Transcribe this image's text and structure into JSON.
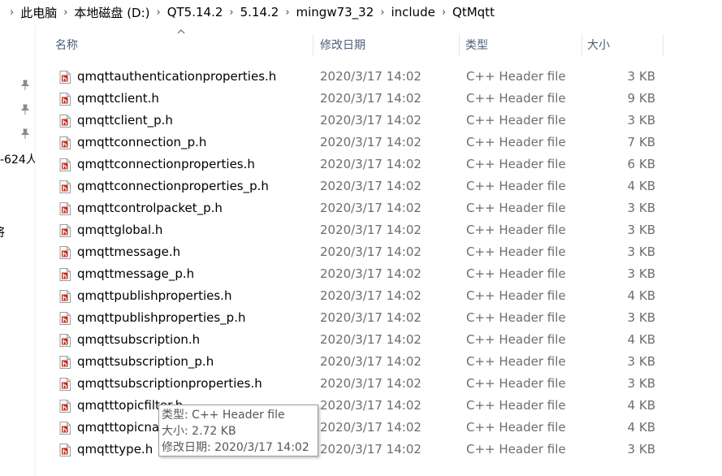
{
  "breadcrumb": {
    "items": [
      "此电脑",
      "本地磁盘 (D:)",
      "QT5.14.2",
      "5.14.2",
      "mingw73_32",
      "include",
      "QtMqtt"
    ],
    "separator": "›"
  },
  "nav": {
    "fragment_1": "-624人",
    "fragment_2": "将"
  },
  "columns": {
    "name": "名称",
    "date": "修改日期",
    "type": "类型",
    "size": "大小"
  },
  "files": [
    {
      "name": "qmqttauthenticationproperties.h",
      "date": "2020/3/17 14:02",
      "type": "C++ Header file",
      "size": "3 KB"
    },
    {
      "name": "qmqttclient.h",
      "date": "2020/3/17 14:02",
      "type": "C++ Header file",
      "size": "9 KB"
    },
    {
      "name": "qmqttclient_p.h",
      "date": "2020/3/17 14:02",
      "type": "C++ Header file",
      "size": "3 KB"
    },
    {
      "name": "qmqttconnection_p.h",
      "date": "2020/3/17 14:02",
      "type": "C++ Header file",
      "size": "7 KB"
    },
    {
      "name": "qmqttconnectionproperties.h",
      "date": "2020/3/17 14:02",
      "type": "C++ Header file",
      "size": "6 KB"
    },
    {
      "name": "qmqttconnectionproperties_p.h",
      "date": "2020/3/17 14:02",
      "type": "C++ Header file",
      "size": "4 KB"
    },
    {
      "name": "qmqttcontrolpacket_p.h",
      "date": "2020/3/17 14:02",
      "type": "C++ Header file",
      "size": "3 KB"
    },
    {
      "name": "qmqttglobal.h",
      "date": "2020/3/17 14:02",
      "type": "C++ Header file",
      "size": "3 KB"
    },
    {
      "name": "qmqttmessage.h",
      "date": "2020/3/17 14:02",
      "type": "C++ Header file",
      "size": "3 KB"
    },
    {
      "name": "qmqttmessage_p.h",
      "date": "2020/3/17 14:02",
      "type": "C++ Header file",
      "size": "3 KB"
    },
    {
      "name": "qmqttpublishproperties.h",
      "date": "2020/3/17 14:02",
      "type": "C++ Header file",
      "size": "4 KB"
    },
    {
      "name": "qmqttpublishproperties_p.h",
      "date": "2020/3/17 14:02",
      "type": "C++ Header file",
      "size": "3 KB"
    },
    {
      "name": "qmqttsubscription.h",
      "date": "2020/3/17 14:02",
      "type": "C++ Header file",
      "size": "4 KB"
    },
    {
      "name": "qmqttsubscription_p.h",
      "date": "2020/3/17 14:02",
      "type": "C++ Header file",
      "size": "3 KB"
    },
    {
      "name": "qmqttsubscriptionproperties.h",
      "date": "2020/3/17 14:02",
      "type": "C++ Header file",
      "size": "3 KB"
    },
    {
      "name": "qmqtttopicfilter.h",
      "date": "2020/3/17 14:02",
      "type": "C++ Header file",
      "size": "4 KB"
    },
    {
      "name": "qmqtttopicname.h",
      "date": "2020/3/17 14:02",
      "type": "C++ Header file",
      "size": "4 KB"
    },
    {
      "name": "qmqtttype.h",
      "date": "2020/3/17 14:02",
      "type": "C++ Header file",
      "size": "3 KB"
    }
  ],
  "tooltip": {
    "type_line": "类型: C++ Header file",
    "size_line": "大小: 2.72 KB",
    "date_line": "修改日期: 2020/3/17 14:02"
  },
  "icons": {
    "file": "cpp-header-file-icon",
    "pin": "pin-icon",
    "sort": "sort-up-icon"
  },
  "colors": {
    "header_text": "#4c607a",
    "secondary_text": "#6d6d6d",
    "file_icon_red": "#c42b1c"
  }
}
